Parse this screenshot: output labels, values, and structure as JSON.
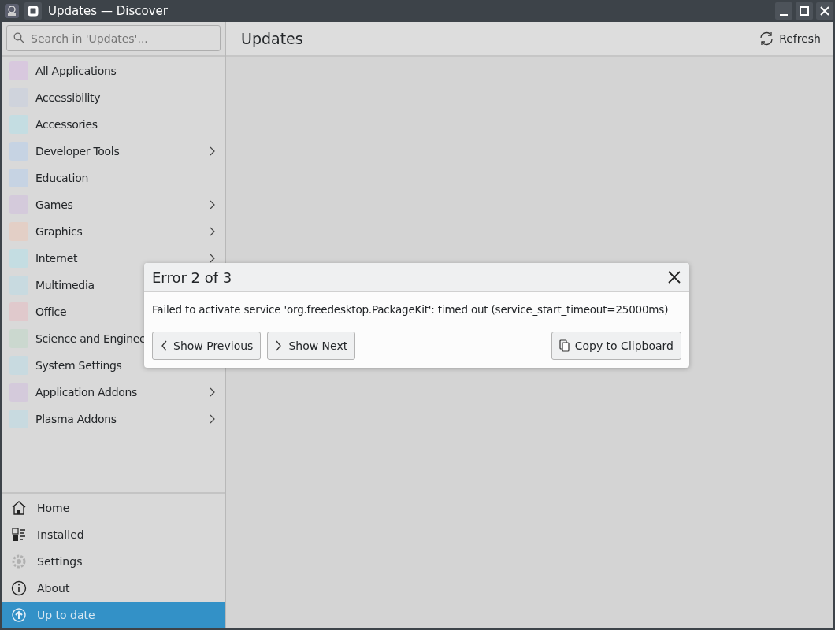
{
  "window": {
    "title": "Updates — Discover"
  },
  "search": {
    "placeholder": "Search in 'Updates'..."
  },
  "categories": [
    {
      "label": "All Applications",
      "color": "#d8c8de",
      "has_children": false
    },
    {
      "label": "Accessibility",
      "color": "#cfd3dc",
      "has_children": false
    },
    {
      "label": "Accessories",
      "color": "#c4dde2",
      "has_children": false
    },
    {
      "label": "Developer Tools",
      "color": "#c6d3e3",
      "has_children": true
    },
    {
      "label": "Education",
      "color": "#c6d3e3",
      "has_children": false
    },
    {
      "label": "Games",
      "color": "#d4cadb",
      "has_children": true
    },
    {
      "label": "Graphics",
      "color": "#e3cfc6",
      "has_children": true
    },
    {
      "label": "Internet",
      "color": "#c4dde2",
      "has_children": true
    },
    {
      "label": "Multimedia",
      "color": "#c8dae0"
    },
    {
      "label": "Office",
      "color": "#e0c9cc"
    },
    {
      "label": "Science and Enginee",
      "color": "#cbd8cf"
    },
    {
      "label": "System Settings",
      "color": "#c8dae0"
    },
    {
      "label": "Application Addons",
      "color": "#d4cadb",
      "has_children": true
    },
    {
      "label": "Plasma Addons",
      "color": "#c8dae0",
      "has_children": true
    }
  ],
  "nav": [
    {
      "label": "Home",
      "kind": "home",
      "selected": false,
      "disabled": false
    },
    {
      "label": "Installed",
      "kind": "installed",
      "selected": false,
      "disabled": false
    },
    {
      "label": "Settings",
      "kind": "settings",
      "selected": false,
      "disabled": true
    },
    {
      "label": "About",
      "kind": "about",
      "selected": false,
      "disabled": false
    },
    {
      "label": "Up to date",
      "kind": "update",
      "selected": true,
      "disabled": false
    }
  ],
  "page": {
    "title": "Updates",
    "action": "Refresh"
  },
  "dialog": {
    "title": "Error 2 of 3",
    "message": "Failed to activate service 'org.freedesktop.PackageKit': timed out (service_start_timeout=25000ms)",
    "buttons": [
      {
        "label": "Show Previous",
        "kind": "previous"
      },
      {
        "label": "Show Next",
        "kind": "next"
      },
      {
        "label": "Copy to Clipboard",
        "kind": "copy"
      }
    ]
  }
}
